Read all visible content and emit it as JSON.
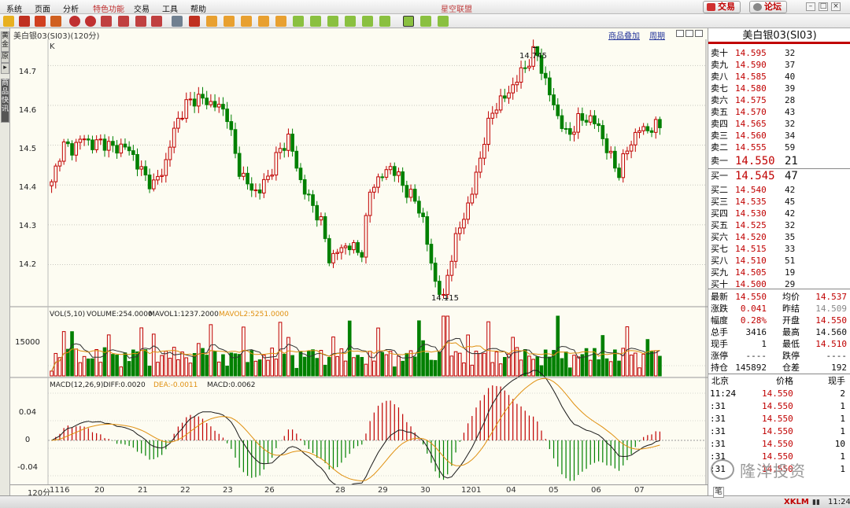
{
  "menu": {
    "items": [
      "系统",
      "页面",
      "分析",
      "特色功能",
      "交易",
      "工具",
      "帮助"
    ],
    "app_title": "星空联盟",
    "trade_btn": "交易",
    "forum_btn": "论坛"
  },
  "left_tabs": [
    "黄金",
    "原",
    "▸",
    "商品快讯"
  ],
  "chart": {
    "title": "美白银03(SI03)(120分)",
    "overlay_link": "商品叠加",
    "period_link": "周期",
    "k_label": "K",
    "price_axis": [
      "14.7",
      "14.6",
      "14.5",
      "14.4",
      "14.3",
      "14.2"
    ],
    "high_label": "14.745",
    "low_label": "14.115",
    "vol_legend": {
      "a": "VOL(5,10)",
      "b": "VOLUME:254.0000",
      "c": "MAVOL1:1237.2000",
      "d": "MAVOL2:5251.0000"
    },
    "vol_axis": "15000",
    "macd_legend": {
      "a": "MACD(12,26,9)",
      "b": "DIFF:0.0020",
      "c": "DEA:-0.0011",
      "d": "MACD:0.0062"
    },
    "macd_axis": [
      "0.04",
      "0",
      "-0.04"
    ],
    "date_axis": [
      "120分",
      "1116",
      "20",
      "21",
      "22",
      "23",
      "26",
      "28",
      "29",
      "30",
      "1201",
      "04",
      "05",
      "06",
      "07"
    ],
    "colors": {
      "up": "#c00000",
      "down": "#008000",
      "diff": "#1a1a1a",
      "dea": "#e09010"
    }
  },
  "chart_data": {
    "type": "candlestick",
    "title": "美白银03(SI03)(120分)",
    "ylim": [
      14.11,
      14.75
    ],
    "high": 14.745,
    "low": 14.115,
    "ticks": [
      14.2,
      14.3,
      14.4,
      14.5,
      14.6,
      14.7
    ],
    "close_path": [
      14.4,
      14.5,
      14.49,
      14.52,
      14.5,
      14.51,
      14.49,
      14.5,
      14.47,
      14.42,
      14.4,
      14.45,
      14.55,
      14.6,
      14.62,
      14.61,
      14.6,
      14.58,
      14.45,
      14.4,
      14.38,
      14.42,
      14.48,
      14.52,
      14.42,
      14.36,
      14.32,
      14.21,
      14.24,
      14.25,
      14.22,
      14.4,
      14.42,
      14.45,
      14.4,
      14.37,
      14.32,
      14.17,
      14.12,
      14.25,
      14.32,
      14.4,
      14.52,
      14.6,
      14.62,
      14.66,
      14.7,
      14.74,
      14.65,
      14.58,
      14.52,
      14.56,
      14.57,
      14.55,
      14.48,
      14.43,
      14.5,
      14.54,
      14.54,
      14.55
    ]
  },
  "quote": {
    "title": "美白银03(SI03)",
    "asks": [
      [
        "卖十",
        "14.595",
        "32"
      ],
      [
        "卖九",
        "14.590",
        "37"
      ],
      [
        "卖八",
        "14.585",
        "40"
      ],
      [
        "卖七",
        "14.580",
        "39"
      ],
      [
        "卖六",
        "14.575",
        "28"
      ],
      [
        "卖五",
        "14.570",
        "43"
      ],
      [
        "卖四",
        "14.565",
        "32"
      ],
      [
        "卖三",
        "14.560",
        "34"
      ],
      [
        "卖二",
        "14.555",
        "59"
      ],
      [
        "卖一",
        "14.550",
        "21"
      ]
    ],
    "bids": [
      [
        "买一",
        "14.545",
        "47"
      ],
      [
        "买二",
        "14.540",
        "42"
      ],
      [
        "买三",
        "14.535",
        "45"
      ],
      [
        "买四",
        "14.530",
        "42"
      ],
      [
        "买五",
        "14.525",
        "32"
      ],
      [
        "买六",
        "14.520",
        "35"
      ],
      [
        "买七",
        "14.515",
        "33"
      ],
      [
        "买八",
        "14.510",
        "51"
      ],
      [
        "买九",
        "14.505",
        "19"
      ],
      [
        "买十",
        "14.500",
        "29"
      ]
    ],
    "stats": [
      [
        "最新",
        "14.550",
        "均价",
        "14.537"
      ],
      [
        "涨跌",
        "0.041",
        "昨结",
        "14.509"
      ],
      [
        "幅度",
        "0.28%",
        "开盘",
        "14.550"
      ],
      [
        "总手",
        "3416",
        "最高",
        "14.560"
      ],
      [
        "现手",
        "1",
        "最低",
        "14.510"
      ],
      [
        "涨停",
        "----",
        "跌停",
        "----"
      ],
      [
        "持仓",
        "145892",
        "仓差",
        "192"
      ]
    ],
    "tick_head": [
      "北京",
      "价格",
      "现手"
    ],
    "ticks": [
      [
        "11:24",
        "14.550",
        "2"
      ],
      [
        ":31",
        "14.550",
        "1"
      ],
      [
        ":31",
        "14.550",
        "1"
      ],
      [
        ":31",
        "14.550",
        "1"
      ],
      [
        ":31",
        "14.550",
        "10"
      ],
      [
        ":31",
        "14.550",
        "1"
      ],
      [
        ":31",
        "14.550",
        "1"
      ]
    ]
  },
  "status": {
    "logo": "XKLM",
    "clock": "11:24",
    "side_btn": "笔"
  },
  "watermark": "隆洋投资"
}
